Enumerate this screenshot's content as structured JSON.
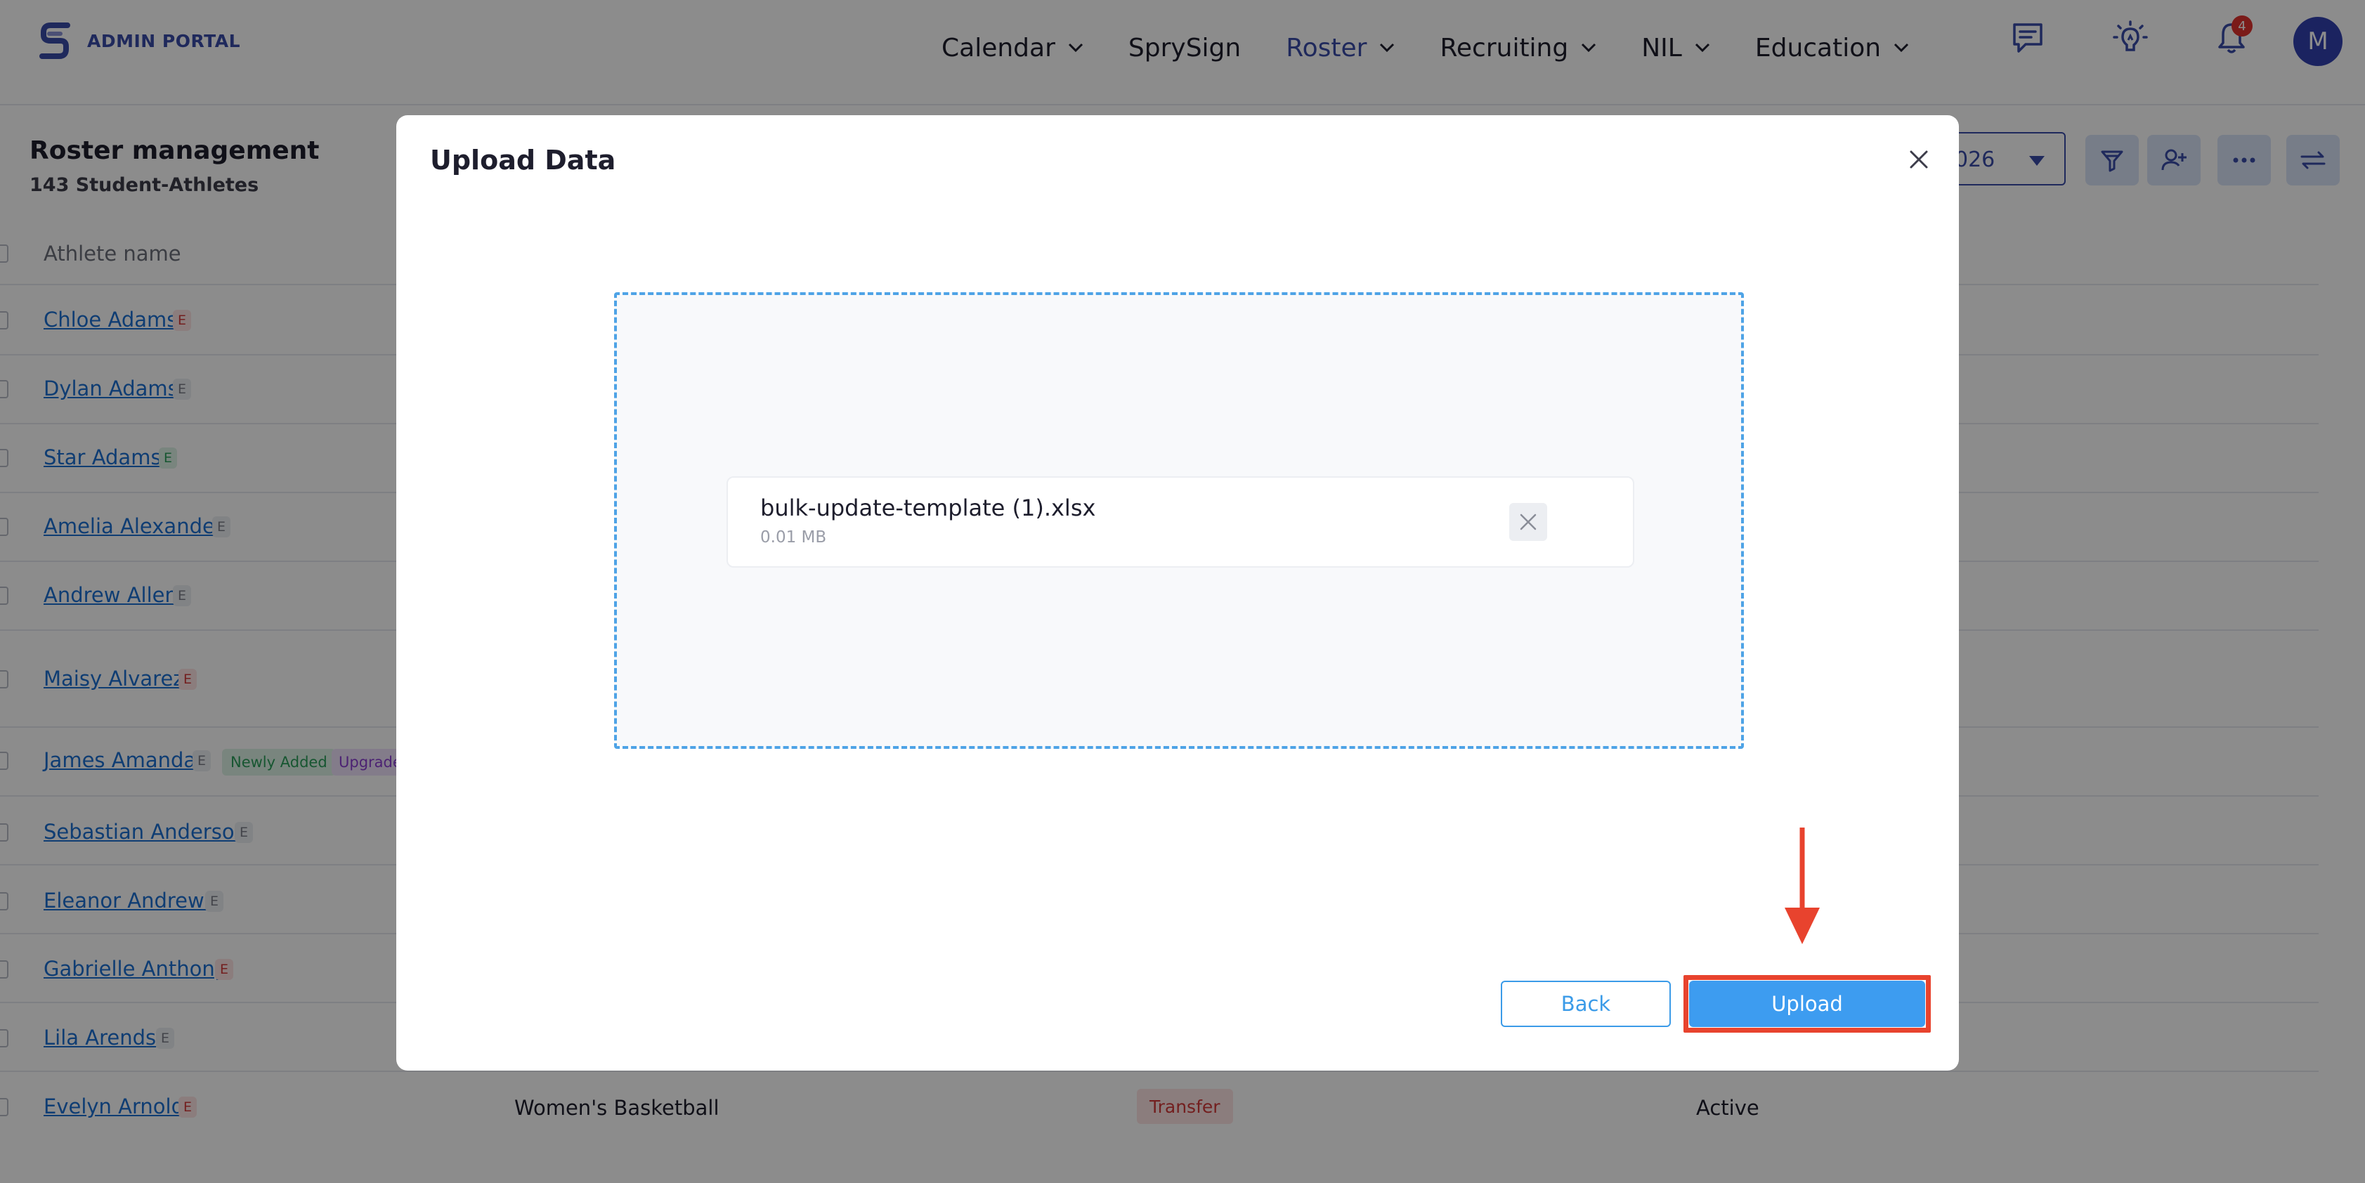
{
  "brand": {
    "name": "ADMIN PORTAL",
    "accent": "#3a4ba8"
  },
  "nav": {
    "items": [
      {
        "label": "Calendar",
        "dropdown": true,
        "active": false
      },
      {
        "label": "SprySign",
        "dropdown": false,
        "active": false
      },
      {
        "label": "Roster",
        "dropdown": true,
        "active": true
      },
      {
        "label": "Recruiting",
        "dropdown": true,
        "active": false
      },
      {
        "label": "NIL",
        "dropdown": true,
        "active": false
      },
      {
        "label": "Education",
        "dropdown": true,
        "active": false
      }
    ],
    "icons": [
      "chat-icon",
      "lightbulb-icon",
      "bell-icon"
    ],
    "notification_count": "4",
    "avatar_initial": "M"
  },
  "page": {
    "title": "Roster management",
    "subtitle": "143 Student-Athletes",
    "season_partial": "026",
    "column_header": "Athlete name",
    "tools": [
      "filter-icon",
      "add-user-icon",
      "more-icon",
      "swap-icon"
    ]
  },
  "roster": {
    "rows": [
      {
        "name": "Chloe Adams",
        "badge": "E",
        "badge_color": "red"
      },
      {
        "name": "Dylan Adams",
        "badge": "E",
        "badge_color": "gray"
      },
      {
        "name": "Star Adams",
        "badge": "E",
        "badge_color": "green"
      },
      {
        "name": "Amelia Alexander",
        "badge": "E",
        "badge_color": "gray"
      },
      {
        "name": "Andrew Allen",
        "badge": "E",
        "badge_color": "gray"
      },
      {
        "name": "Maisy Alvarez",
        "badge": "E",
        "badge_color": "red"
      },
      {
        "name": "James Amanda",
        "badge": "E",
        "badge_color": "gray"
      },
      {
        "name": "Sebastian Anderson",
        "badge": "E",
        "badge_color": "gray"
      },
      {
        "name": "Eleanor Andrews",
        "badge": "E",
        "badge_color": "gray"
      },
      {
        "name": "Gabrielle Anthony",
        "badge": "E",
        "badge_color": "red"
      },
      {
        "name": "Lila Arends",
        "badge": "E",
        "badge_color": "gray"
      },
      {
        "name": "Evelyn Arnold",
        "badge": "E",
        "badge_color": "red"
      }
    ],
    "tags": {
      "newly_added": "Newly Added",
      "upgrade": "Upgrade"
    },
    "last_row": {
      "sport": "Women's Basketball",
      "tag": "Transfer",
      "status": "Active"
    }
  },
  "modal": {
    "title": "Upload Data",
    "file": {
      "name": "bulk-update-template (1).xlsx",
      "size": "0.01 MB"
    },
    "back_label": "Back",
    "upload_label": "Upload"
  },
  "colors": {
    "primary_blue": "#3d9cf0",
    "dropzone_border": "#4ea3e6",
    "highlight_red": "#e8432e",
    "link_blue": "#1d6fd1"
  }
}
